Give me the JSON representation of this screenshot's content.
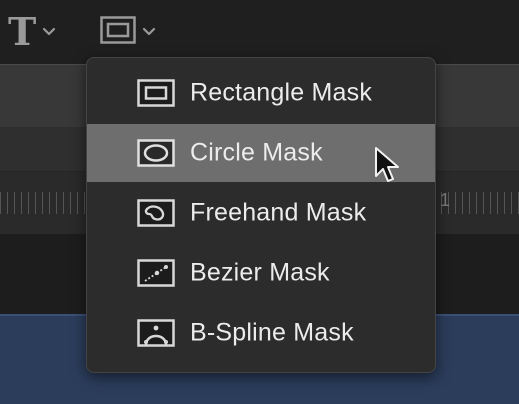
{
  "toolbar": {
    "text_tool_glyph": "T",
    "text_tool_icon": "text-tool-icon",
    "mask_tool_icon": "mask-rectangle-icon",
    "dropdown_icon": "chevron-down-icon"
  },
  "ruler": {
    "visible_number": "1"
  },
  "mask_menu": {
    "highlighted_index": 1,
    "items": [
      {
        "label": "Rectangle Mask",
        "icon": "rectangle-mask-icon"
      },
      {
        "label": "Circle Mask",
        "icon": "circle-mask-icon"
      },
      {
        "label": "Freehand Mask",
        "icon": "freehand-mask-icon"
      },
      {
        "label": "Bezier Mask",
        "icon": "bezier-mask-icon"
      },
      {
        "label": "B-Spline Mask",
        "icon": "bspline-mask-icon"
      }
    ]
  },
  "colors": {
    "menu_background": "#2c2c2c",
    "highlight": "#6e6e6e",
    "text": "#ececec",
    "timeline_blue": "#2b3d5b"
  }
}
